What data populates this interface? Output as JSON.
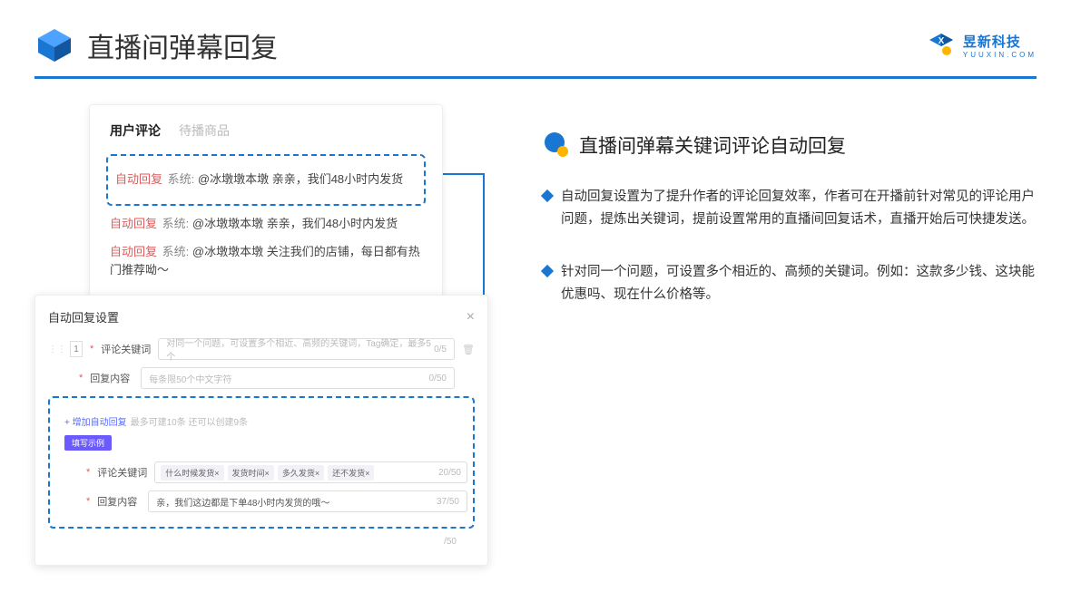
{
  "header": {
    "title": "直播间弹幕回复",
    "brand_name": "昱新科技",
    "brand_url": "YUUXIN.COM"
  },
  "comment_card": {
    "tab_active": "用户评论",
    "tab_inactive": "待播商品",
    "items": [
      {
        "tag": "自动回复",
        "sys": "系统:",
        "text": "@冰墩墩本墩 亲亲，我们48小时内发货",
        "highlight": true
      },
      {
        "tag": "自动回复",
        "sys": "系统:",
        "text": "@冰墩墩本墩 亲亲，我们48小时内发货",
        "highlight": false
      },
      {
        "tag": "自动回复",
        "sys": "系统:",
        "text": "@冰墩墩本墩 关注我们的店铺，每日都有热门推荐呦～",
        "highlight": false
      }
    ]
  },
  "settings": {
    "dialog_title": "自动回复设置",
    "row_num": "1",
    "keyword_label": "评论关键词",
    "keyword_placeholder": "对同一个问题，可设置多个相近、高频的关键词，Tag确定，最多5个",
    "keyword_counter": "0/5",
    "content_label": "回复内容",
    "content_placeholder": "每条限50个中文字符",
    "content_counter": "0/50",
    "add_link": "+ 增加自动回复",
    "add_hint": "最多可建10条 还可以创建9条",
    "example_badge": "填写示例",
    "ex_keyword_label": "评论关键词",
    "ex_tags": [
      "什么时候发货×",
      "发货时间×",
      "多久发货×",
      "还不发货×"
    ],
    "ex_keyword_counter": "20/50",
    "ex_content_label": "回复内容",
    "ex_content_value": "亲，我们这边都是下单48小时内发货的哦～",
    "ex_content_counter": "37/50",
    "extra_counter": "/50"
  },
  "right": {
    "section_title": "直播间弹幕关键词评论自动回复",
    "bullets": [
      "自动回复设置为了提升作者的评论回复效率，作者可在开播前针对常见的评论用户问题，提炼出关键词，提前设置常用的直播间回复话术，直播开始后可快捷发送。",
      "针对同一个问题，可设置多个相近的、高频的关键词。例如：这款多少钱、这块能优惠吗、现在什么价格等。"
    ]
  }
}
